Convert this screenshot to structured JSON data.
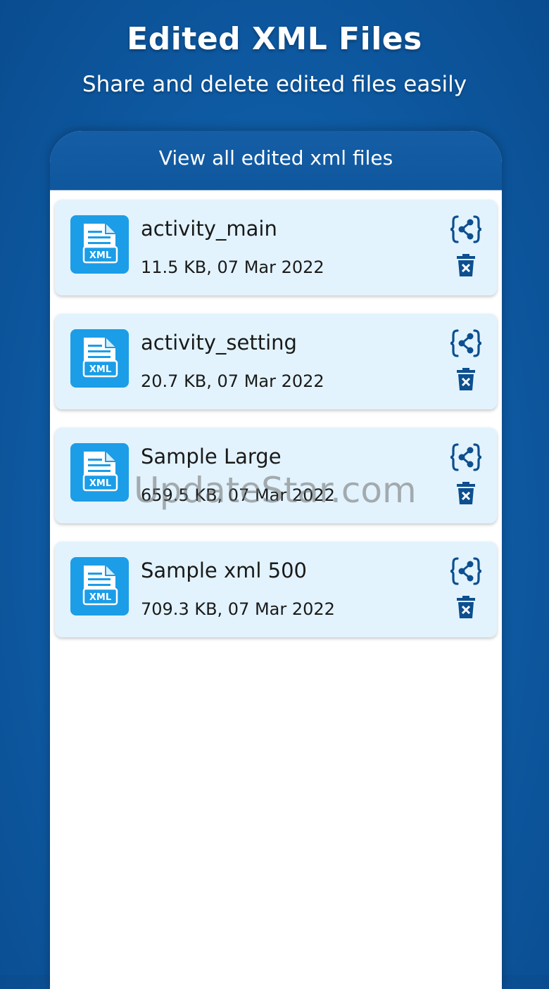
{
  "hero": {
    "title": "Edited XML Files",
    "subtitle": "Share and delete edited files easily"
  },
  "screen": {
    "header_title": "View all edited xml files"
  },
  "files": [
    {
      "name": "activity_main",
      "meta": "11.5 KB, 07 Mar 2022",
      "icon_label": "XML"
    },
    {
      "name": "activity_setting",
      "meta": "20.7 KB, 07 Mar 2022",
      "icon_label": "XML"
    },
    {
      "name": "Sample Large",
      "meta": "659.5 KB, 07 Mar 2022",
      "icon_label": "XML"
    },
    {
      "name": "Sample xml 500",
      "meta": "709.3 KB, 07 Mar 2022",
      "icon_label": "XML"
    }
  ],
  "icons": {
    "file": "xml-file-icon",
    "share": "share-code-icon",
    "delete": "trash-icon"
  },
  "watermark": "UpdateStar.com",
  "colors": {
    "background": "#0f5ea8",
    "header": "#155ea6",
    "card": "#e2f3fd",
    "file_icon": "#1b9de8",
    "action_icon": "#0d4f8f"
  }
}
